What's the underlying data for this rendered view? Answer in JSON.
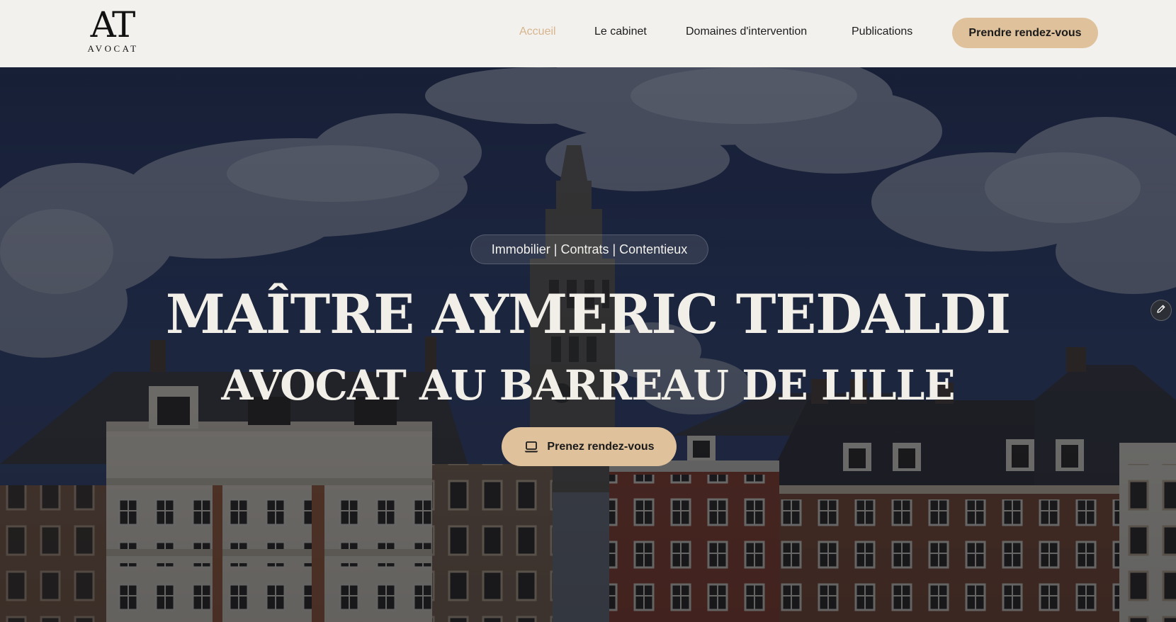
{
  "header": {
    "logo": {
      "mark": "AT",
      "sub": "AVOCAT"
    },
    "nav": [
      {
        "label": "Accueil",
        "active": true
      },
      {
        "label": "Le cabinet",
        "active": false
      },
      {
        "label": "Domaines d'intervention",
        "active": false
      },
      {
        "label": "Publications",
        "active": false
      }
    ],
    "cta_label": "Prendre rendez-vous"
  },
  "hero": {
    "tagline": "Immobilier | Contrats | Contentieux",
    "title": "MAÎTRE AYMERIC TEDALDI",
    "subtitle": "AVOCAT AU BARREAU DE LILLE",
    "cta_label": "Prenez rendez-vous",
    "cta_icon": "laptop-icon",
    "edit_icon": "pencil-icon"
  },
  "colors": {
    "header_bg": "#f2f1ed",
    "accent": "#dfc19b",
    "active_link": "#d7b58d",
    "text_dark": "#1b1b1b",
    "hero_text": "#f2efe8"
  }
}
